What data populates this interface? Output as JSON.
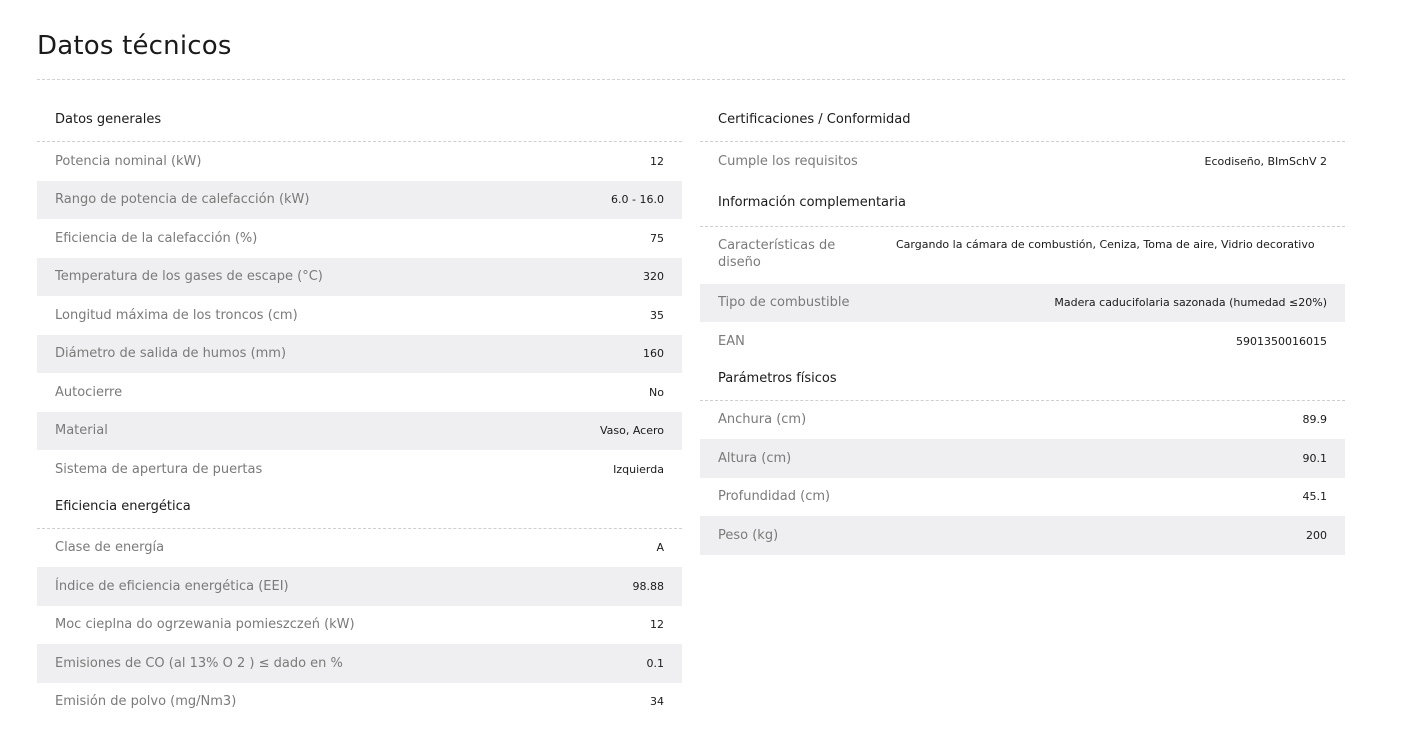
{
  "title": "Datos técnicos",
  "left": {
    "general": {
      "title": "Datos generales",
      "rows": [
        {
          "label": "Potencia nominal (kW)",
          "value": "12"
        },
        {
          "label": "Rango de potencia de calefacción (kW)",
          "value": "6.0 - 16.0"
        },
        {
          "label": "Eficiencia de la calefacción (%)",
          "value": "75"
        },
        {
          "label": "Temperatura de los gases de escape (°C)",
          "value": "320"
        },
        {
          "label": "Longitud máxima de los troncos (cm)",
          "value": "35"
        },
        {
          "label": "Diámetro de salida de humos (mm)",
          "value": "160"
        },
        {
          "label": "Autocierre",
          "value": "No"
        },
        {
          "label": "Material",
          "value": "Vaso, Acero"
        },
        {
          "label": "Sistema de apertura de puertas",
          "value": "Izquierda"
        }
      ]
    },
    "energy": {
      "title": "Eficiencia energética",
      "rows": [
        {
          "label": "Clase de energía",
          "value": "A"
        },
        {
          "label": "Índice de eficiencia energética (EEI)",
          "value": "98.88"
        },
        {
          "label": "Moc cieplna do ogrzewania pomieszczeń (kW)",
          "value": "12"
        },
        {
          "label": "Emisiones de CO (al 13% O 2 ) ≤ dado en %",
          "value": "0.1"
        },
        {
          "label": "Emisión de polvo (mg/Nm3)",
          "value": "34"
        }
      ]
    }
  },
  "right": {
    "certs": {
      "title": "Certificaciones / Conformidad",
      "rows": [
        {
          "label": "Cumple los requisitos",
          "value": "Ecodiseño, BImSchV 2"
        }
      ]
    },
    "info": {
      "title": "Información complementaria",
      "rows": [
        {
          "label": "Características de diseño",
          "value": "Cargando la cámara de combustión, Ceniza, Toma de aire, Vidrio decorativo"
        },
        {
          "label": "Tipo de combustible",
          "value": "Madera caducifolaria sazonada (humedad ≤20%)"
        },
        {
          "label": "EAN",
          "value": "5901350016015"
        }
      ]
    },
    "physical": {
      "title": "Parámetros físicos",
      "rows": [
        {
          "label": "Anchura (cm)",
          "value": "89.9"
        },
        {
          "label": "Altura (cm)",
          "value": "90.1"
        },
        {
          "label": "Profundidad (cm)",
          "value": "45.1"
        },
        {
          "label": "Peso (kg)",
          "value": "200"
        }
      ]
    }
  }
}
